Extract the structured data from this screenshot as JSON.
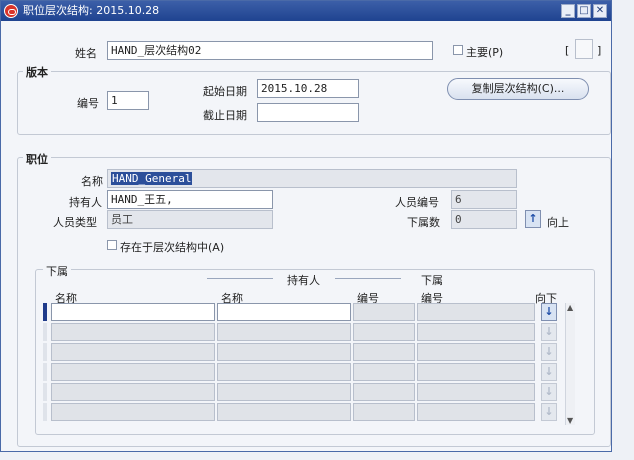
{
  "window": {
    "title": "职位层次结构: 2015.10.28",
    "minimize": "_",
    "maximize": "□",
    "close": "✕"
  },
  "top": {
    "name_label": "姓名",
    "name_value": "HAND_层次结构02",
    "primary_label": "主要(P)",
    "bracket_open": "[",
    "bracket_close": "]"
  },
  "version": {
    "title": "版本",
    "number_label": "编号",
    "number_value": "1",
    "start_label": "起始日期",
    "start_value": "2015.10.28",
    "end_label": "截止日期",
    "end_value": "",
    "copy_button": "复制层次结构(C)..."
  },
  "position": {
    "title": "职位",
    "name_label": "名称",
    "name_value": "HAND_General",
    "holder_label": "持有人",
    "holder_value": "HAND_王五,",
    "emp_type_label": "人员类型",
    "emp_type_value": "员工",
    "emp_no_label": "人员编号",
    "emp_no_value": "6",
    "sub_count_label": "下属数",
    "sub_count_value": "0",
    "up_label": "向上",
    "exists_label": "存在于层次结构中(A)"
  },
  "subordinates": {
    "title": "下属",
    "holder_group": "持有人",
    "sub_group": "下属",
    "col_name": "名称",
    "col_holder_name": "名称",
    "col_holder_no": "编号",
    "col_sub_no": "编号",
    "col_down": "向下",
    "rows": 6
  },
  "colors": {
    "titlebar": "#1f4390",
    "selection": "#2c4f9a",
    "accent": "#1f4ea8"
  }
}
